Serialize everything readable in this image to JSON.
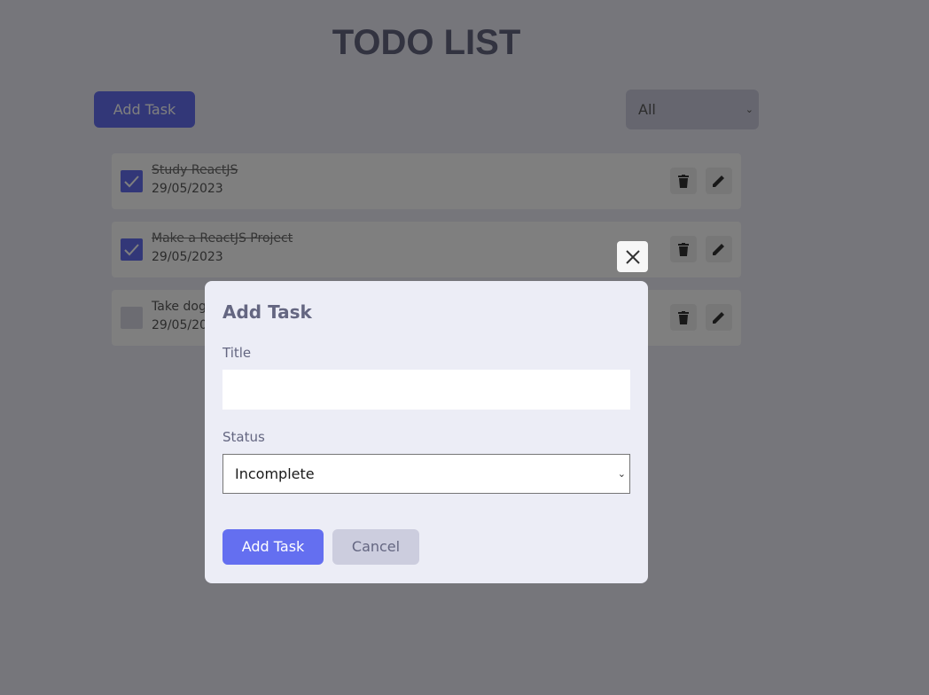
{
  "app": {
    "title": "TODO LIST",
    "add_task_label": "Add Task",
    "filter": {
      "selected": "All"
    }
  },
  "todos": [
    {
      "title": "Study ReactJS",
      "date": "29/05/2023",
      "completed": true
    },
    {
      "title": "Make a ReactJS Project",
      "date": "29/05/2023",
      "completed": true
    },
    {
      "title": "Take dog",
      "date": "29/05/20",
      "completed": false
    }
  ],
  "modal": {
    "heading": "Add Task",
    "title_label": "Title",
    "title_value": "",
    "status_label": "Status",
    "status_value": "Incomplete",
    "submit_label": "Add Task",
    "cancel_label": "Cancel"
  },
  "colors": {
    "primary": "#646ff0",
    "secondary": "#cccdde",
    "text_muted": "#646681"
  },
  "icons": {
    "delete": "trash-icon",
    "edit": "pencil-icon",
    "close": "close-icon",
    "check": "check-icon",
    "select_arrow": "chevron-down-icon"
  }
}
